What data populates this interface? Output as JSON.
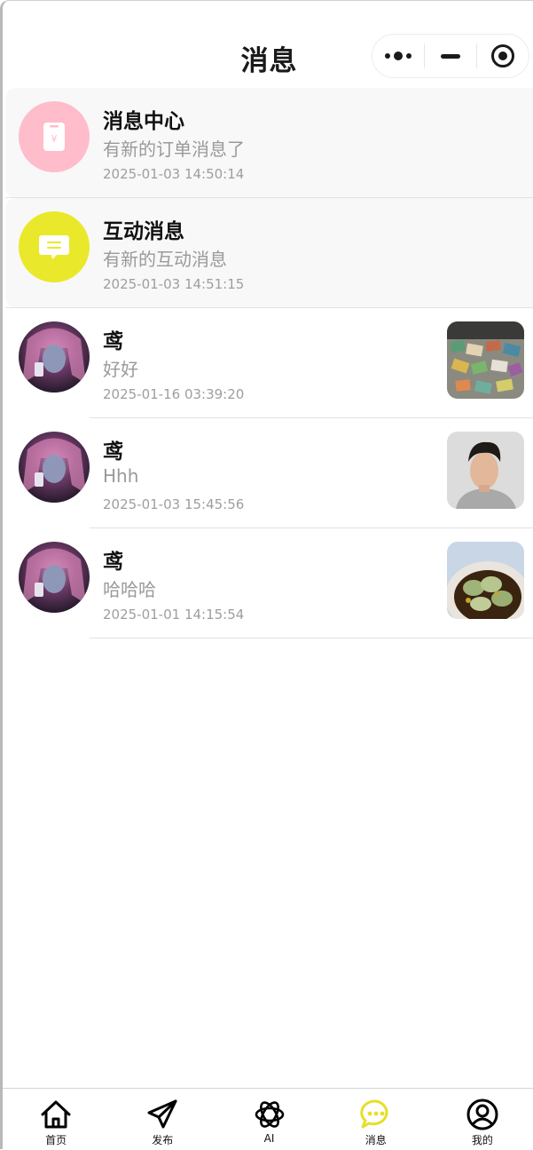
{
  "header": {
    "title": "消息"
  },
  "system_items": [
    {
      "name": "消息中心",
      "preview": "有新的订单消息了",
      "time": "2025-01-03 14:50:14",
      "icon": "order-icon",
      "color": "#ffbccb"
    },
    {
      "name": "互动消息",
      "preview": "有新的互动消息",
      "time": "2025-01-03 14:51:15",
      "icon": "chat-icon",
      "color": "#eae82a"
    }
  ],
  "chats": [
    {
      "name": "鸢",
      "preview": "好好",
      "time": "2025-01-16 03:39:20",
      "thumb": "snacks-photo"
    },
    {
      "name": "鸢",
      "preview": "Hhh",
      "time": "2025-01-03 15:45:56",
      "thumb": "portrait-photo"
    },
    {
      "name": "鸢",
      "preview": "哈哈哈",
      "time": "2025-01-01 14:15:54",
      "thumb": "dumplings-photo"
    }
  ],
  "tabbar": {
    "active_color": "#e7df27",
    "items": [
      {
        "label": "首页",
        "icon": "home-icon"
      },
      {
        "label": "发布",
        "icon": "send-icon"
      },
      {
        "label": "AI",
        "icon": "ai-icon"
      },
      {
        "label": "消息",
        "icon": "message-icon",
        "active": true
      },
      {
        "label": "我的",
        "icon": "user-icon"
      }
    ]
  }
}
